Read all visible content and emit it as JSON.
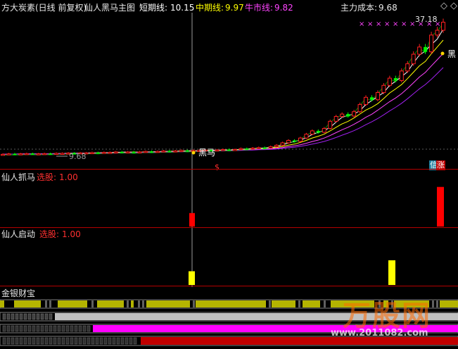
{
  "main_panel": {
    "title": "方大炭素(日线 前复权)",
    "indicator_name": "仙人黑马主图",
    "lines": [
      {
        "label": "短期线:",
        "value": "10.15",
        "color": "#ffffff"
      },
      {
        "label": "中期线:",
        "value": "9.97",
        "color": "#ffff00"
      },
      {
        "label": "牛市线:",
        "value": "9.82",
        "color": "#ff44ff"
      }
    ],
    "cost_label": "主力成本:",
    "cost_value": "9.68",
    "price_high": "37.18",
    "price_low": "9.68",
    "black_horse_marker": "黑马",
    "black_horse_marker_right": "黑",
    "dollar_marker": "$",
    "rise_badge": "涨",
    "rise_badge_prefix": "信"
  },
  "panel_grab": {
    "name": "仙人抓马",
    "select_label": "选股:",
    "select_value": "1.00"
  },
  "panel_launch": {
    "name": "仙人启动",
    "select_label": "选股:",
    "select_value": "1.00"
  },
  "panel_gold": {
    "name": "金银财宝"
  },
  "watermark": {
    "brand": "万股网",
    "url": "www.2011082.com"
  },
  "colors": {
    "bg": "#000000",
    "separator": "#b40000",
    "up": "#ff2020",
    "down": "#00ff00",
    "yellow": "#ffff00",
    "magenta": "#ff00ff",
    "olive": "#b4b400",
    "gray": "#c0c0c0"
  },
  "chart_data": [
    {
      "type": "candlestick",
      "title": "方大炭素(日线 前复权)",
      "series": [
        {
          "name": "短期线",
          "last": 10.15
        },
        {
          "name": "中期线",
          "last": 9.97
        },
        {
          "name": "牛市线",
          "last": 9.82
        },
        {
          "name": "主力成本",
          "last": 9.68
        }
      ],
      "price_labels": [
        37.18,
        9.68
      ],
      "closes": [
        9.6,
        9.7,
        9.65,
        9.7,
        9.75,
        9.7,
        9.7,
        9.75,
        9.7,
        9.8,
        9.8,
        9.85,
        9.8,
        9.9,
        9.9,
        9.95,
        9.9,
        10.0,
        10.0,
        10.1,
        10.05,
        10.1,
        10.0,
        10.1,
        10.2,
        10.1,
        10.2,
        10.3,
        10.2,
        10.3,
        10.4,
        10.3,
        10.4,
        10.4,
        10.5,
        10.4,
        10.5,
        10.6,
        10.5,
        10.6,
        10.8,
        10.7,
        10.9,
        11.0,
        10.9,
        11.2,
        11.5,
        12.0,
        12.5,
        12.3,
        13.0,
        13.8,
        14.5,
        14.2,
        15.0,
        16.5,
        17.5,
        18.0,
        17.6,
        18.5,
        20.0,
        21.5,
        21.0,
        22.5,
        24.0,
        25.5,
        25.0,
        27.0,
        28.5,
        30.5,
        32.0,
        31.0,
        34.5,
        35.5,
        37.18
      ]
    },
    {
      "type": "bar",
      "name": "仙人抓马",
      "series": [
        {
          "name": "选股",
          "values": [
            1.0,
            1.0
          ]
        }
      ],
      "ylim": [
        0,
        1
      ]
    },
    {
      "type": "bar",
      "name": "仙人启动",
      "series": [
        {
          "name": "选股",
          "values": [
            1.0,
            1.0
          ]
        }
      ],
      "ylim": [
        0,
        1
      ]
    }
  ]
}
